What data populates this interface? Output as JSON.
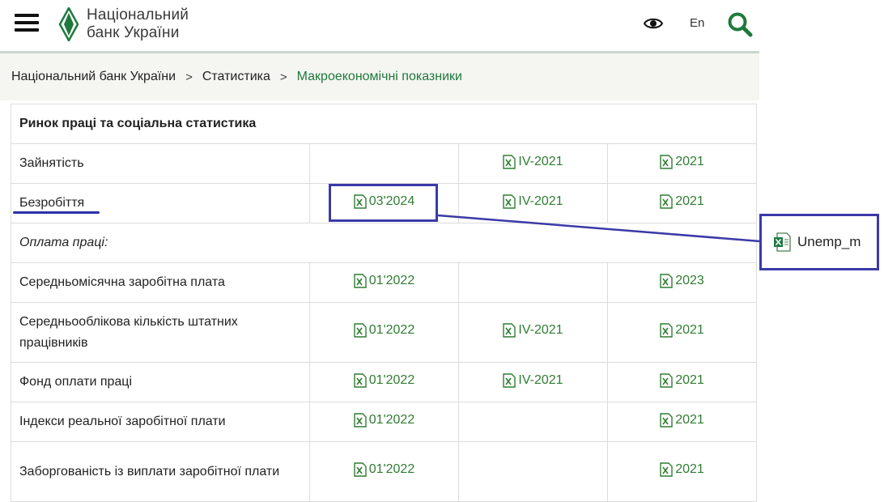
{
  "header": {
    "logo_line1": "Національний",
    "logo_line2": "банк України",
    "lang": "En"
  },
  "breadcrumb": [
    {
      "label": "Національний банк України"
    },
    {
      "label": "Статистика"
    },
    {
      "label": "Макроекономічні показники"
    }
  ],
  "table": {
    "section_title": "Ринок праці та соціальна статистика",
    "rows": [
      {
        "label": "Зайнятість",
        "c2": "",
        "c3": "IV-2021",
        "c4": "2021"
      },
      {
        "label": "Безробіття",
        "c2": "03'2024",
        "c3": "IV-2021",
        "c4": "2021"
      },
      {
        "label": "Оплата праці:"
      },
      {
        "label": "Середньомісячна заробітна плата",
        "c2": "01'2022",
        "c3": "",
        "c4": "2023"
      },
      {
        "label": "Середньооблікова кількість штатних працівників",
        "c2": "01'2022",
        "c3": "IV-2021",
        "c4": "2021"
      },
      {
        "label": "Фонд оплати праці",
        "c2": "01'2022",
        "c3": "IV-2021",
        "c4": "2021"
      },
      {
        "label": "Індекси реальної заробітної плати",
        "c2": "01'2022",
        "c3": "",
        "c4": "2021"
      },
      {
        "label": "Заборгованість із виплати заробітної плати",
        "c2": "01'2022",
        "c3": "",
        "c4": "2021"
      }
    ]
  },
  "callout": {
    "file_name": "Unemp_m"
  },
  "colors": {
    "brand_green": "#1e7a3c",
    "link_green": "#2f7d32",
    "annotation_blue": "#3b3aa8"
  },
  "icons": [
    "menu-icon",
    "nbu-logo",
    "eye-icon",
    "search-icon",
    "excel-file-icon"
  ]
}
